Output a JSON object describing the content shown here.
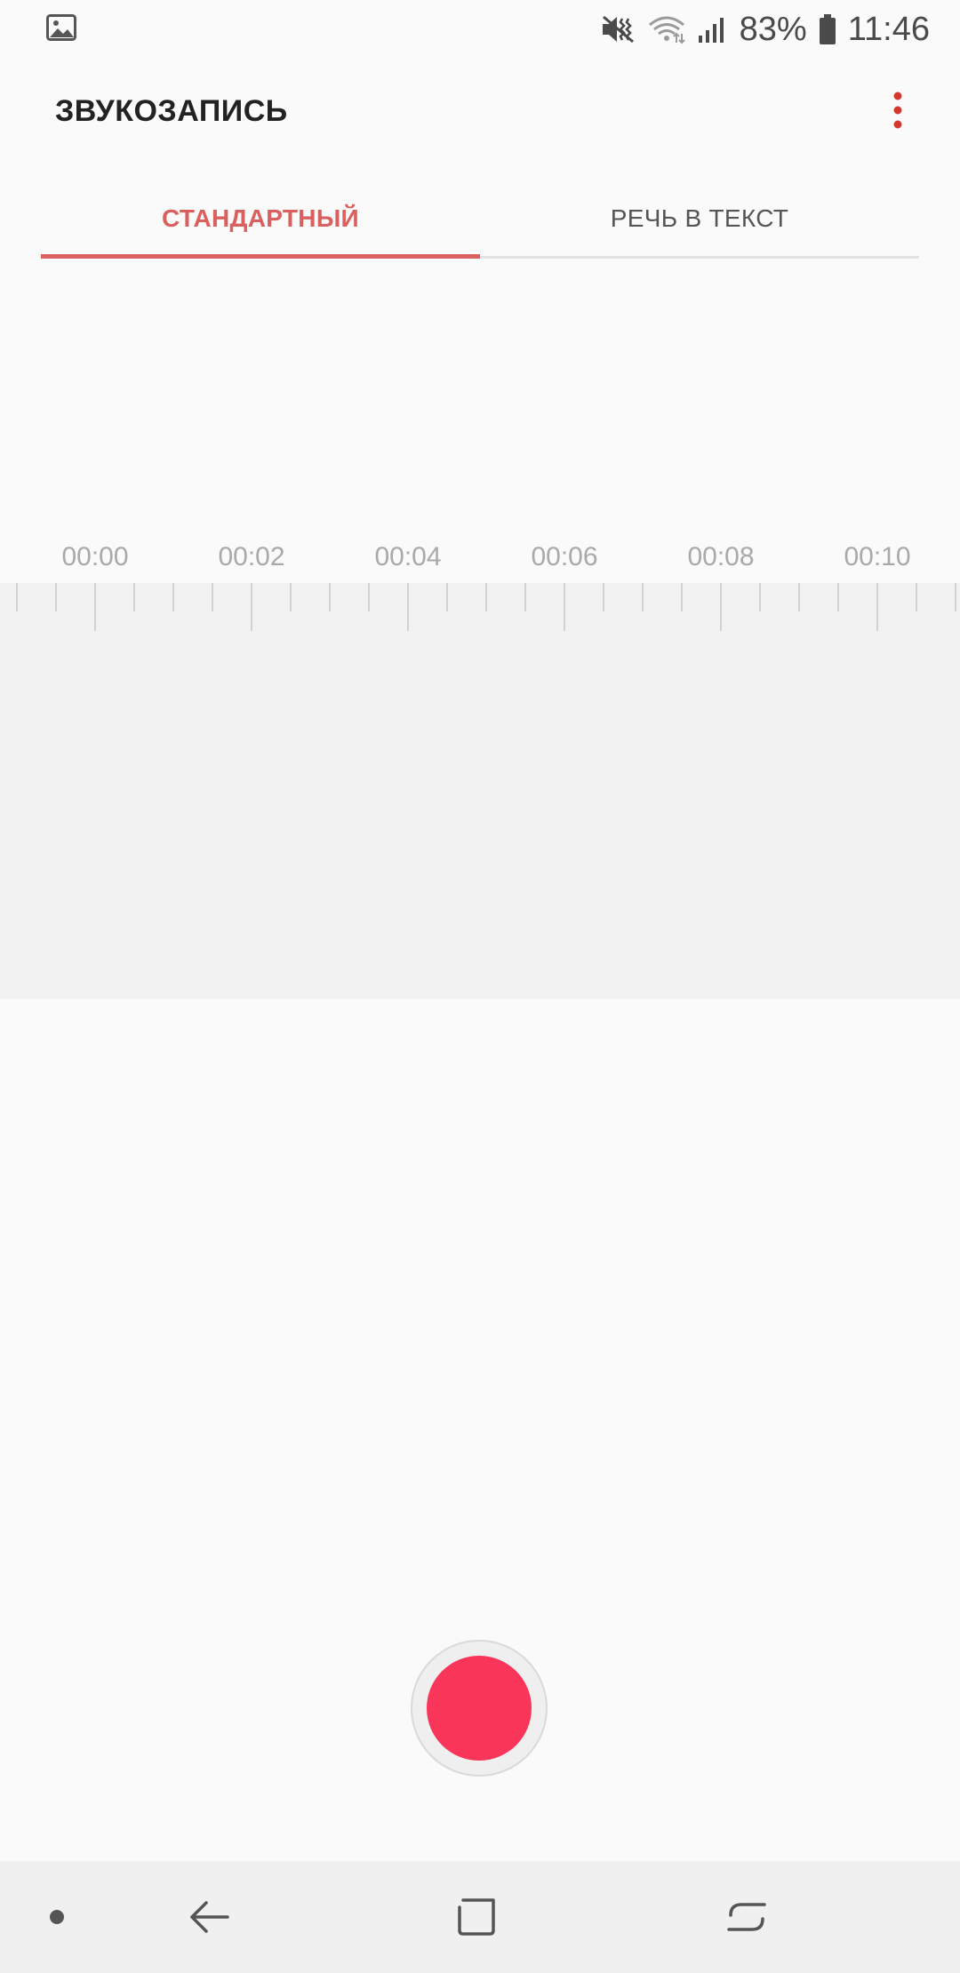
{
  "status_bar": {
    "left_icon": "gallery-notification-icon",
    "mute_icon": "vibrate-mute-icon",
    "wifi_icon": "wifi-icon",
    "signal_icon": "signal-icon",
    "battery_icon": "battery-icon",
    "battery_percent": "83%",
    "time": "11:46"
  },
  "app": {
    "title": "ЗВУКОЗАПИСЬ",
    "more_icon": "more-vert-icon",
    "accent_color": "#d9605f",
    "record_color": "#f9355a"
  },
  "tabs": [
    {
      "label": "СТАНДАРТНЫЙ",
      "selected": true
    },
    {
      "label": "РЕЧЬ В ТЕКСТ",
      "selected": false
    }
  ],
  "timeline": {
    "labels": [
      "00:00",
      "00:02",
      "00:04",
      "00:06",
      "00:08",
      "00:10"
    ]
  },
  "controls": {
    "record_icon": "record-icon"
  },
  "nav_bar": {
    "items": [
      "dot-icon",
      "back-icon",
      "home-icon",
      "recent-apps-icon"
    ]
  }
}
